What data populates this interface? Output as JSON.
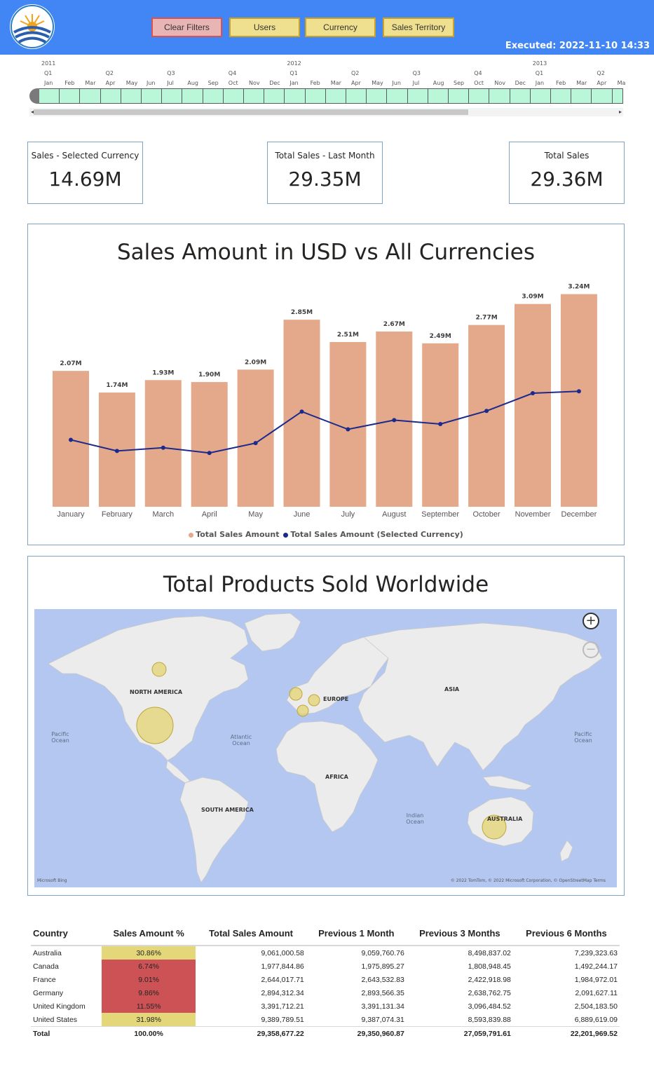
{
  "header": {
    "buttons": [
      {
        "label": "Clear Filters"
      },
      {
        "label": "Users"
      },
      {
        "label": "Currency"
      },
      {
        "label": "Sales Territory"
      }
    ],
    "executed": "Executed: 2022-11-10 14:33"
  },
  "timeline": {
    "years": [
      {
        "label": "2011"
      },
      {
        "label": "2012"
      },
      {
        "label": "2013"
      }
    ],
    "quarters": [
      "Q1",
      "Q2",
      "Q3",
      "Q4",
      "Q1",
      "Q2",
      "Q3",
      "Q4",
      "Q1",
      "Q2"
    ],
    "months": [
      "Jan",
      "Feb",
      "Mar",
      "Apr",
      "May",
      "Jun",
      "Jul",
      "Aug",
      "Sep",
      "Oct",
      "Nov",
      "Dec",
      "Jan",
      "Feb",
      "Mar",
      "Apr",
      "May",
      "Jun",
      "Jul",
      "Aug",
      "Sep",
      "Oct",
      "Nov",
      "Dec",
      "Jan",
      "Feb",
      "Mar",
      "Apr",
      "Ma"
    ]
  },
  "kpis": [
    {
      "title": "Sales - Selected Currency",
      "value": "14.69M"
    },
    {
      "title": "Total Sales - Last Month",
      "value": "29.35M"
    },
    {
      "title": "Total Sales",
      "value": "29.36M"
    }
  ],
  "sales_chart": {
    "title": "Sales Amount in USD vs All Currencies",
    "legend": [
      "Total Sales Amount",
      "Total Sales Amount (Selected Currency)"
    ],
    "colors": {
      "bar": "#e4a98a",
      "line": "#1b2a8c"
    }
  },
  "chart_data": {
    "type": "bar",
    "title": "Sales Amount in USD vs All Currencies",
    "categories": [
      "January",
      "February",
      "March",
      "April",
      "May",
      "June",
      "July",
      "August",
      "September",
      "October",
      "November",
      "December"
    ],
    "series": [
      {
        "name": "Total Sales Amount",
        "type": "bar",
        "values": [
          2.07,
          1.74,
          1.93,
          1.9,
          2.09,
          2.85,
          2.51,
          2.67,
          2.49,
          2.77,
          3.09,
          3.24
        ],
        "labels": [
          "2.07M",
          "1.74M",
          "1.93M",
          "1.90M",
          "2.09M",
          "2.85M",
          "2.51M",
          "2.67M",
          "2.49M",
          "2.77M",
          "3.09M",
          "3.24M"
        ]
      },
      {
        "name": "Total Sales Amount (Selected Currency)",
        "type": "line",
        "values": [
          1.02,
          0.85,
          0.9,
          0.82,
          0.97,
          1.45,
          1.18,
          1.32,
          1.26,
          1.46,
          1.73,
          1.76
        ]
      }
    ],
    "ylim": [
      0,
      3.3
    ]
  },
  "map": {
    "title": "Total Products Sold Worldwide",
    "labels": [
      "NORTH AMERICA",
      "EUROPE",
      "ASIA",
      "AFRICA",
      "SOUTH AMERICA",
      "AUSTRALIA"
    ],
    "oceans": [
      "Pacific Ocean",
      "Atlantic Ocean",
      "Indian Ocean",
      "Pacific Ocean"
    ],
    "attribution": "© 2022 TomTom, © 2022 Microsoft Corporation, © OpenStreetMap  Terms",
    "bing": "Microsoft Bing"
  },
  "table": {
    "headers": [
      "Country",
      "Sales Amount %",
      "Total Sales Amount",
      "Previous 1 Month",
      "Previous 3 Months",
      "Previous 6 Months"
    ],
    "rows": [
      {
        "country": "Australia",
        "pct": "30.86%",
        "status": "high",
        "total": "9,061,000.58",
        "p1": "9,059,760.76",
        "p3": "8,498,837.02",
        "p6": "7,239,323.63"
      },
      {
        "country": "Canada",
        "pct": "6.74%",
        "status": "low",
        "total": "1,977,844.86",
        "p1": "1,975,895.27",
        "p3": "1,808,948.45",
        "p6": "1,492,244.17"
      },
      {
        "country": "France",
        "pct": "9.01%",
        "status": "low",
        "total": "2,644,017.71",
        "p1": "2,643,532.83",
        "p3": "2,422,918.98",
        "p6": "1,984,972.01"
      },
      {
        "country": "Germany",
        "pct": "9.86%",
        "status": "low",
        "total": "2,894,312.34",
        "p1": "2,893,566.35",
        "p3": "2,638,762.75",
        "p6": "2,091,627.11"
      },
      {
        "country": "United Kingdom",
        "pct": "11.55%",
        "status": "low",
        "total": "3,391,712.21",
        "p1": "3,391,131.34",
        "p3": "3,096,484.52",
        "p6": "2,504,183.50"
      },
      {
        "country": "United States",
        "pct": "31.98%",
        "status": "high",
        "total": "9,389,789.51",
        "p1": "9,387,074.31",
        "p3": "8,593,839.88",
        "p6": "6,889,619.09"
      }
    ],
    "total": {
      "country": "Total",
      "pct": "100.00%",
      "total": "29,358,677.22",
      "p1": "29,350,960.87",
      "p3": "27,059,791.61",
      "p6": "22,201,969.52"
    },
    "status_colors": {
      "high": "#e3d77a",
      "low": "#cc5256"
    }
  }
}
